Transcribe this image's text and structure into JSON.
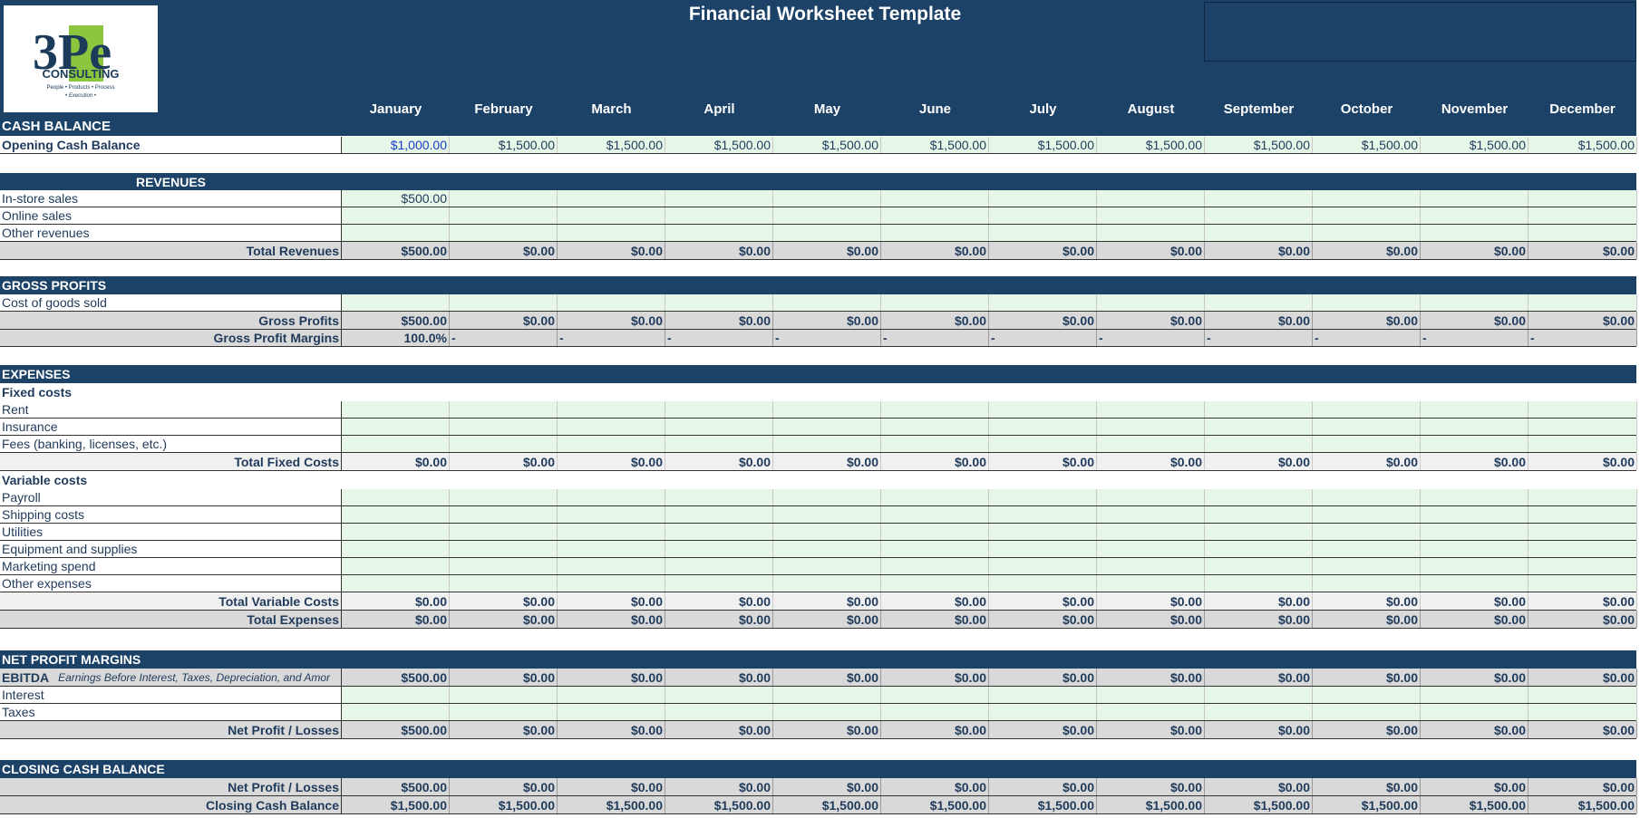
{
  "title": "Financial Worksheet Template",
  "logo": {
    "text": "3Pe",
    "sub": "CONSULTING",
    "tag": "People • Products • Process",
    "tag2": "• Execution •"
  },
  "months": [
    "January",
    "February",
    "March",
    "April",
    "May",
    "June",
    "July",
    "August",
    "September",
    "October",
    "November",
    "December"
  ],
  "cash_balance": {
    "section": "CASH BALANCE",
    "opening_label": "Opening Cash Balance",
    "opening": [
      "$1,000.00",
      "$1,500.00",
      "$1,500.00",
      "$1,500.00",
      "$1,500.00",
      "$1,500.00",
      "$1,500.00",
      "$1,500.00",
      "$1,500.00",
      "$1,500.00",
      "$1,500.00",
      "$1,500.00"
    ]
  },
  "revenues": {
    "section": "REVENUES",
    "in_store": {
      "label": "In-store sales",
      "values": [
        "$500.00",
        "",
        "",
        "",
        "",
        "",
        "",
        "",
        "",
        "",
        "",
        ""
      ]
    },
    "online": {
      "label": "Online sales"
    },
    "other": {
      "label": "Other revenues"
    },
    "total": {
      "label": "Total Revenues",
      "values": [
        "$500.00",
        "$0.00",
        "$0.00",
        "$0.00",
        "$0.00",
        "$0.00",
        "$0.00",
        "$0.00",
        "$0.00",
        "$0.00",
        "$0.00",
        "$0.00"
      ]
    }
  },
  "gross": {
    "section": "GROSS PROFITS",
    "cogs": {
      "label": "Cost of goods sold"
    },
    "profits": {
      "label": "Gross Profits",
      "values": [
        "$500.00",
        "$0.00",
        "$0.00",
        "$0.00",
        "$0.00",
        "$0.00",
        "$0.00",
        "$0.00",
        "$0.00",
        "$0.00",
        "$0.00",
        "$0.00"
      ]
    },
    "margins": {
      "label": "Gross Profit Margins",
      "values": [
        "100.0%",
        "-",
        "-",
        "-",
        "-",
        "-",
        "-",
        "-",
        "-",
        "-",
        "-",
        "-"
      ]
    }
  },
  "expenses": {
    "section": "EXPENSES",
    "fixed_head": "Fixed costs",
    "rent": {
      "label": "Rent"
    },
    "insurance": {
      "label": "Insurance"
    },
    "fees": {
      "label": "Fees (banking, licenses, etc.)"
    },
    "total_fixed": {
      "label": "Total Fixed Costs",
      "values": [
        "$0.00",
        "$0.00",
        "$0.00",
        "$0.00",
        "$0.00",
        "$0.00",
        "$0.00",
        "$0.00",
        "$0.00",
        "$0.00",
        "$0.00",
        "$0.00"
      ]
    },
    "variable_head": "Variable costs",
    "payroll": {
      "label": "Payroll"
    },
    "shipping": {
      "label": "Shipping costs"
    },
    "utilities": {
      "label": "Utilities"
    },
    "equipment": {
      "label": "Equipment and supplies"
    },
    "marketing": {
      "label": "Marketing spend"
    },
    "other": {
      "label": "Other expenses"
    },
    "total_variable": {
      "label": "Total Variable Costs",
      "values": [
        "$0.00",
        "$0.00",
        "$0.00",
        "$0.00",
        "$0.00",
        "$0.00",
        "$0.00",
        "$0.00",
        "$0.00",
        "$0.00",
        "$0.00",
        "$0.00"
      ]
    },
    "total": {
      "label": "Total Expenses",
      "values": [
        "$0.00",
        "$0.00",
        "$0.00",
        "$0.00",
        "$0.00",
        "$0.00",
        "$0.00",
        "$0.00",
        "$0.00",
        "$0.00",
        "$0.00",
        "$0.00"
      ]
    }
  },
  "net_profit": {
    "section": "NET PROFIT MARGINS",
    "ebitda": {
      "label": "EBITDA",
      "note": "Earnings Before Interest, Taxes, Depreciation, and Amor",
      "values": [
        "$500.00",
        "$0.00",
        "$0.00",
        "$0.00",
        "$0.00",
        "$0.00",
        "$0.00",
        "$0.00",
        "$0.00",
        "$0.00",
        "$0.00",
        "$0.00"
      ]
    },
    "interest": {
      "label": "Interest"
    },
    "taxes": {
      "label": "Taxes"
    },
    "net": {
      "label": "Net Profit  / Losses",
      "values": [
        "$500.00",
        "$0.00",
        "$0.00",
        "$0.00",
        "$0.00",
        "$0.00",
        "$0.00",
        "$0.00",
        "$0.00",
        "$0.00",
        "$0.00",
        "$0.00"
      ]
    }
  },
  "closing": {
    "section": "CLOSING CASH BALANCE",
    "net": {
      "label": "Net Profit / Losses",
      "values": [
        "$500.00",
        "$0.00",
        "$0.00",
        "$0.00",
        "$0.00",
        "$0.00",
        "$0.00",
        "$0.00",
        "$0.00",
        "$0.00",
        "$0.00",
        "$0.00"
      ]
    },
    "balance": {
      "label": "Closing Cash Balance",
      "values": [
        "$1,500.00",
        "$1,500.00",
        "$1,500.00",
        "$1,500.00",
        "$1,500.00",
        "$1,500.00",
        "$1,500.00",
        "$1,500.00",
        "$1,500.00",
        "$1,500.00",
        "$1,500.00",
        "$1,500.00"
      ]
    }
  },
  "colors": {
    "header": "#1c4268",
    "input": "#e6f7e8",
    "total": "#d9d9d9",
    "logo_green": "#8cc63f",
    "logo_navy": "#1c3a5a"
  }
}
